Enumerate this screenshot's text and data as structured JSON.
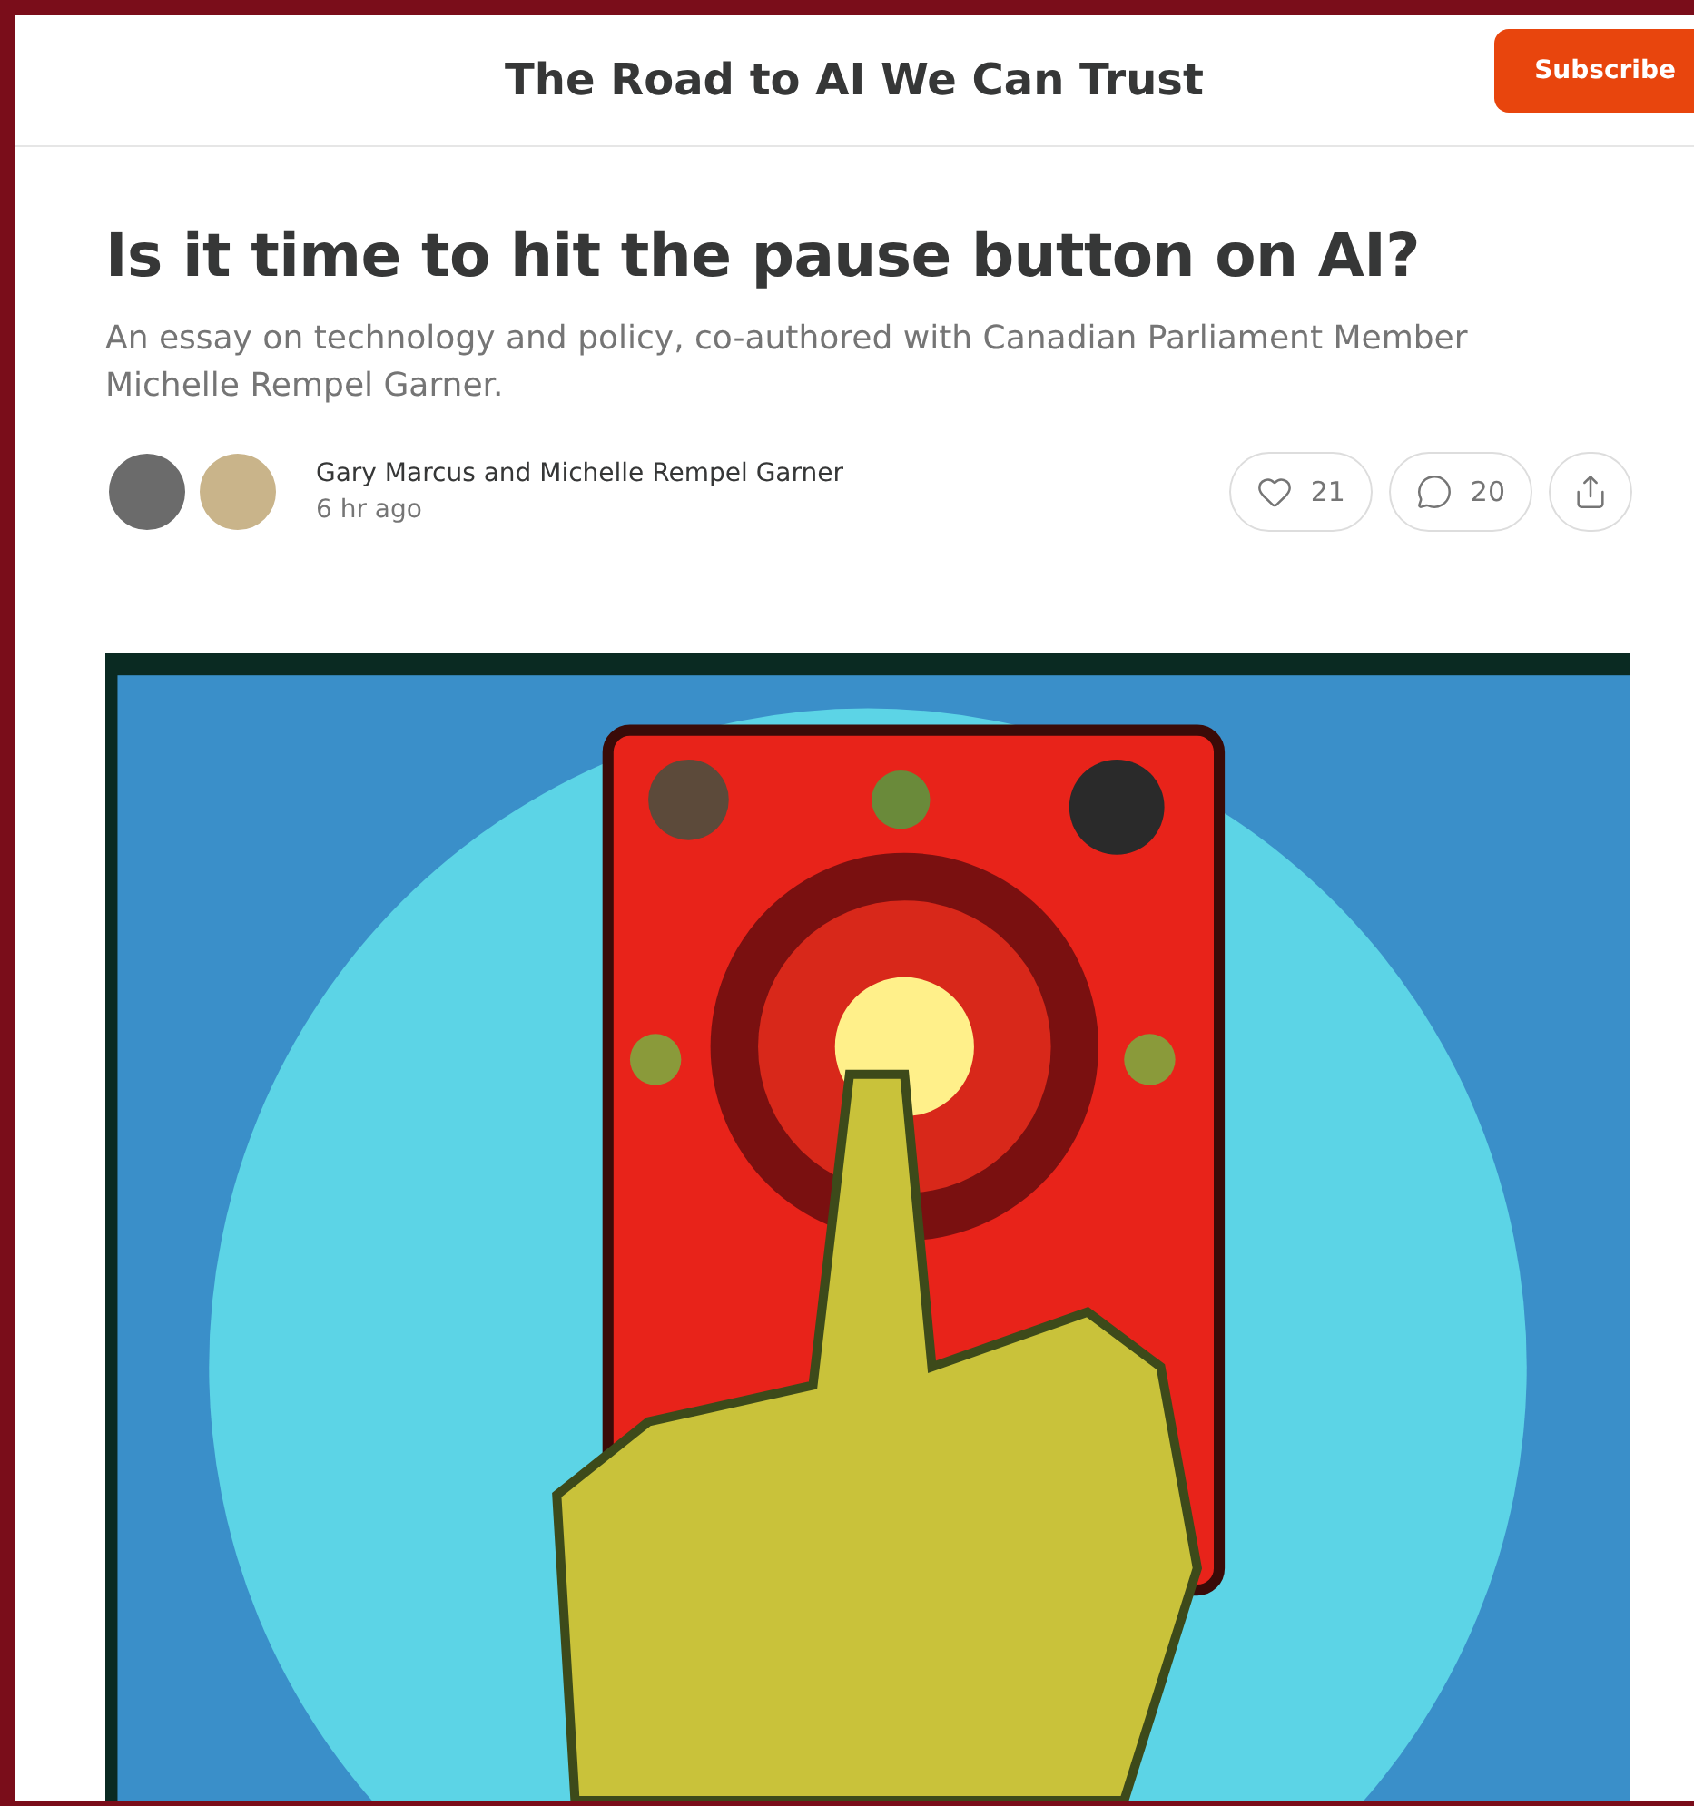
{
  "header": {
    "publication": "The Road to AI We Can Trust",
    "subscribe_button": "Subscribe"
  },
  "post": {
    "title": "Is it time to hit the pause button on AI?",
    "subtitle": "An essay on technology and policy, co-authored with Canadian Parliament Member Michelle Rempel Garner.",
    "authors": "Gary Marcus and Michelle Rempel Garner",
    "time": "6 hr ago",
    "likes": "21",
    "comments": "20"
  }
}
